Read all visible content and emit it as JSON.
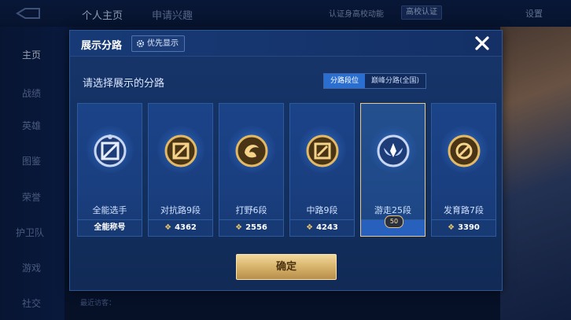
{
  "top_bar": {
    "tabs": [
      "个人主页",
      "申请兴趣"
    ],
    "verify_text": "认证身高校动能",
    "school_badge": "高校认证",
    "settings": "设置"
  },
  "sidebar": {
    "items": [
      {
        "label": "主页",
        "active": true
      },
      {
        "label": "战绩",
        "active": false
      },
      {
        "label": "英雄",
        "active": false
      },
      {
        "label": "图鉴",
        "active": false
      },
      {
        "label": "荣誉",
        "active": false
      },
      {
        "label": "护卫队",
        "active": false
      },
      {
        "label": "游戏",
        "active": false
      },
      {
        "label": "社交",
        "active": false
      }
    ]
  },
  "bottom_hint": "最近访客：",
  "modal": {
    "title": "展示分路",
    "priority_label": "优先显示",
    "subtitle": "请选择展示的分路",
    "segments": [
      {
        "label": "分路段位",
        "active": true
      },
      {
        "label": "巅峰分路(全国)",
        "active": false
      }
    ],
    "cards": [
      {
        "name": "全能选手",
        "footer_text": "全能称号",
        "score": "",
        "selected": false,
        "emblem": "all-round-emblem-icon"
      },
      {
        "name": "对抗路9段",
        "footer_text": "",
        "score": "4362",
        "selected": false,
        "emblem": "clash-lane-emblem-icon"
      },
      {
        "name": "打野6段",
        "footer_text": "",
        "score": "2556",
        "selected": false,
        "emblem": "jungle-emblem-icon"
      },
      {
        "name": "中路9段",
        "footer_text": "",
        "score": "4243",
        "selected": false,
        "emblem": "mid-lane-emblem-icon"
      },
      {
        "name": "游走25段",
        "footer_text": "",
        "score": "",
        "selected": true,
        "badge": "50",
        "emblem": "roam-emblem-icon"
      },
      {
        "name": "发育路7段",
        "footer_text": "",
        "score": "3390",
        "selected": false,
        "emblem": "farm-lane-emblem-icon"
      }
    ],
    "confirm_label": "确定"
  },
  "colors": {
    "accent_gold": "#e8c46a",
    "segment_active": "#2a6fd0",
    "selected_border": "#e9c98a"
  }
}
